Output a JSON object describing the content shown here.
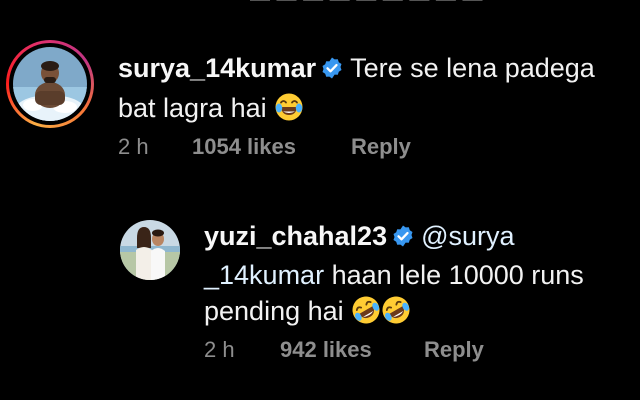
{
  "top_partial_text": "— — — — — — — — —",
  "comments": [
    {
      "username": "surya_14kumar",
      "verified": true,
      "text_line1": "Tere se lena padega",
      "text_line2": "bat lagra hai",
      "emoji": [
        "face-with-tears-of-joy"
      ],
      "time": "2 h",
      "likes": "1054 likes",
      "reply_label": "Reply",
      "has_story_ring": true
    },
    {
      "username": "yuzi_chahal23",
      "verified": true,
      "mention_part1": "@surya",
      "mention_part2": "_14kumar",
      "text_line2_rest": " haan lele 10000 runs",
      "text_line3": "pending hai",
      "emoji": [
        "rolling-on-floor-laughing",
        "rolling-on-floor-laughing"
      ],
      "time": "2 h",
      "likes": "942 likes",
      "reply_label": "Reply",
      "has_story_ring": false
    }
  ],
  "colors": {
    "background": "#000000",
    "text": "#f2f2f2",
    "meta": "#8e8e8e",
    "verified": "#3897f0",
    "mention": "#e0f1ff"
  }
}
